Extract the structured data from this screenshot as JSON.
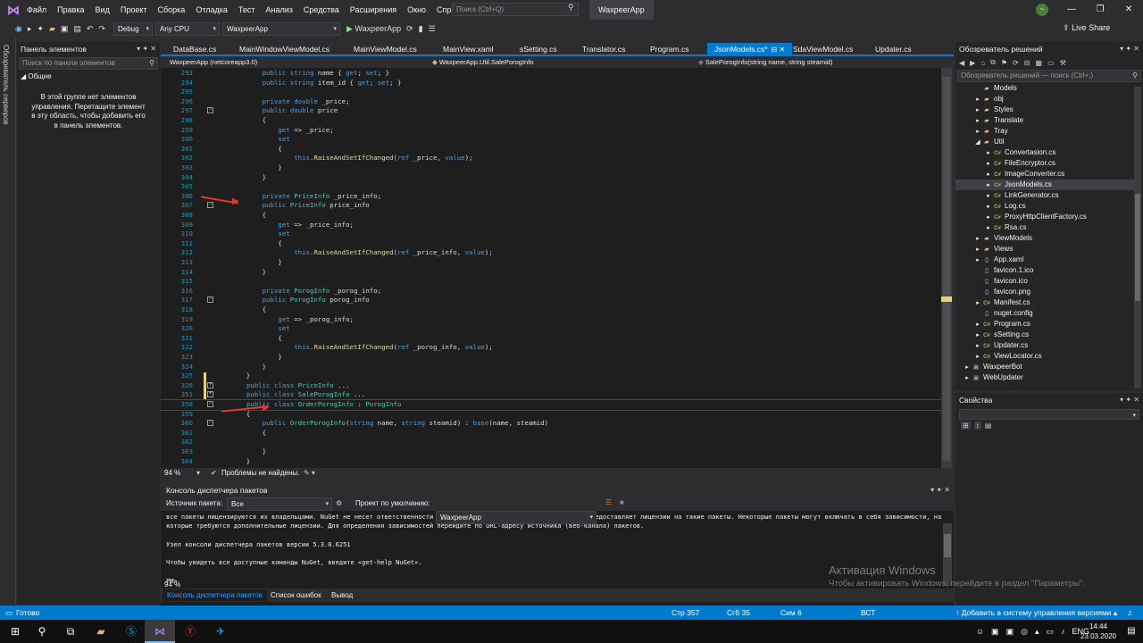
{
  "titlebar": {
    "menus": [
      "Файл",
      "Правка",
      "Вид",
      "Проект",
      "Сборка",
      "Отладка",
      "Тест",
      "Анализ",
      "Средства",
      "Расширения",
      "Окно",
      "Справка"
    ],
    "search_placeholder": "Поиск (Ctrl+Q)",
    "app_name": "WaxpeerApp",
    "live_share": "Live Share"
  },
  "toolbar": {
    "config": "Debug",
    "platform": "Any CPU",
    "startup": "WaxpeerApp",
    "run_label": "WaxpeerApp"
  },
  "sidestrip": {
    "server_explorer": "Обозреватель серверов"
  },
  "toolbox": {
    "title": "Панель элементов",
    "search_placeholder": "Поиск по панели элементов",
    "group": "Общие",
    "empty_text": "В этой группе нет элементов управления. Перетащите элемент в эту область, чтобы добавить его в панель элементов."
  },
  "tabs": [
    {
      "label": "DataBase.cs"
    },
    {
      "label": "MainWindowViewModel.cs"
    },
    {
      "label": "MainViewModel.cs"
    },
    {
      "label": "MainView.xaml"
    },
    {
      "label": "sSetting.cs"
    },
    {
      "label": "Translator.cs"
    },
    {
      "label": "Program.cs"
    },
    {
      "label": "JsonModels.cs*"
    },
    {
      "label": "SdaViewModel.cs"
    },
    {
      "label": "Updater.cs"
    }
  ],
  "navbar": {
    "project": "WaxpeerApp (netcoreapp3.0)",
    "type": "WaxpeerApp.Util.SalePorogInfo",
    "member": "SalePorogInfo(string name, string steamid)"
  },
  "code_lines": [
    {
      "n": "293",
      "t": "        public string name { get; set; }"
    },
    {
      "n": "294",
      "t": "        public string item_id { get; set; }"
    },
    {
      "n": "295",
      "t": ""
    },
    {
      "n": "296",
      "t": "        private double _price;"
    },
    {
      "n": "297",
      "t": "        public double price"
    },
    {
      "n": "298",
      "t": "        {"
    },
    {
      "n": "299",
      "t": "            get => _price;"
    },
    {
      "n": "300",
      "t": "            set"
    },
    {
      "n": "301",
      "t": "            {"
    },
    {
      "n": "302",
      "t": "                this.RaiseAndSetIfChanged(ref _price, value);"
    },
    {
      "n": "303",
      "t": "            }"
    },
    {
      "n": "304",
      "t": "        }"
    },
    {
      "n": "305",
      "t": ""
    },
    {
      "n": "306",
      "t": "        private PriceInfo _price_info;"
    },
    {
      "n": "307",
      "t": "        public PriceInfo price_info"
    },
    {
      "n": "308",
      "t": "        {"
    },
    {
      "n": "309",
      "t": "            get => _price_info;"
    },
    {
      "n": "310",
      "t": "            set"
    },
    {
      "n": "311",
      "t": "            {"
    },
    {
      "n": "312",
      "t": "                this.RaiseAndSetIfChanged(ref _price_info, value);"
    },
    {
      "n": "313",
      "t": "            }"
    },
    {
      "n": "314",
      "t": "        }"
    },
    {
      "n": "315",
      "t": ""
    },
    {
      "n": "316",
      "t": "        private PorogInfo _porog_info;"
    },
    {
      "n": "317",
      "t": "        public PorogInfo porog_info"
    },
    {
      "n": "318",
      "t": "        {"
    },
    {
      "n": "319",
      "t": "            get => _porog_info;"
    },
    {
      "n": "320",
      "t": "            set"
    },
    {
      "n": "321",
      "t": "            {"
    },
    {
      "n": "322",
      "t": "                this.RaiseAndSetIfChanged(ref _porog_info, value);"
    },
    {
      "n": "323",
      "t": "            }"
    },
    {
      "n": "324",
      "t": "        }"
    },
    {
      "n": "325",
      "t": "    }"
    },
    {
      "n": "326",
      "t": "    public class PriceInfo ..."
    },
    {
      "n": "351",
      "t": "    public class SalePorogInfo ..."
    },
    {
      "n": "358",
      "t": "    public class OrderPorogInfo : PorogInfo"
    },
    {
      "n": "359",
      "t": "    {"
    },
    {
      "n": "360",
      "t": "        public OrderPorogInfo(string name, string steamid) : base(name, steamid)"
    },
    {
      "n": "361",
      "t": "        {"
    },
    {
      "n": "362",
      "t": ""
    },
    {
      "n": "363",
      "t": "        }"
    },
    {
      "n": "364",
      "t": "    }"
    }
  ],
  "editor_status": {
    "zoom": "94 %",
    "issues": "Проблемы не найдены."
  },
  "pmc": {
    "title": "Консоль диспетчера пакетов",
    "source_label": "Источник пакета:",
    "source_value": "Все",
    "project_label": "Проект по умолчанию:",
    "project_value": "WaxpeerApp",
    "lines": [
      "все пакеты лицензируются их владельцами. NuGet не несет ответственности за пакеты сторонних производителей и не предоставляет лицензии на такие пакеты. Некоторые пакеты могут включать в себя зависимости, на",
      "которые требуются дополнительные лицензии. Для определения зависимостей перейдите по URL-адресу источника (веб-канала) пакетов.",
      "",
      "Узел консоли диспетчера пакетов версии 5.3.0.6251",
      "",
      "Чтобы увидеть все доступные команды NuGet, введите «get-help NuGet».",
      "",
      "PM>"
    ],
    "zoom": "94 %"
  },
  "bottom_tabs": [
    "Консоль диспетчера пакетов",
    "Список ошибок",
    "Вывод"
  ],
  "solution_explorer": {
    "title": "Обозреватель решений",
    "search_placeholder": "Обозреватель решений — поиск (Ctrl+;)",
    "items": [
      {
        "label": "Models",
        "kind": "folder",
        "depth": 2,
        "exp": ""
      },
      {
        "label": "obj",
        "kind": "folder",
        "depth": 2,
        "exp": "▸"
      },
      {
        "label": "Styles",
        "kind": "folder",
        "depth": 2,
        "exp": "▸"
      },
      {
        "label": "Translate",
        "kind": "folder",
        "depth": 2,
        "exp": "▸"
      },
      {
        "label": "Tray",
        "kind": "folder",
        "depth": 2,
        "exp": "▸"
      },
      {
        "label": "Util",
        "kind": "folder",
        "depth": 2,
        "exp": "◢"
      },
      {
        "label": "Convertasion.cs",
        "kind": "cs",
        "depth": 3,
        "exp": "▸"
      },
      {
        "label": "FileEncryptor.cs",
        "kind": "cs",
        "depth": 3,
        "exp": "▸"
      },
      {
        "label": "ImageConverter.cs",
        "kind": "cs",
        "depth": 3,
        "exp": "▸"
      },
      {
        "label": "JsonModels.cs",
        "kind": "cs",
        "depth": 3,
        "exp": "▸",
        "sel": true
      },
      {
        "label": "LinkGenerator.cs",
        "kind": "cs",
        "depth": 3,
        "exp": "▸"
      },
      {
        "label": "Log.cs",
        "kind": "cs",
        "depth": 3,
        "exp": "▸"
      },
      {
        "label": "ProxyHttpClientFactory.cs",
        "kind": "cs",
        "depth": 3,
        "exp": "▸"
      },
      {
        "label": "Rsa.cs",
        "kind": "cs",
        "depth": 3,
        "exp": "▸"
      },
      {
        "label": "ViewModels",
        "kind": "folder",
        "depth": 2,
        "exp": "▸"
      },
      {
        "label": "Views",
        "kind": "folder",
        "depth": 2,
        "exp": "▸"
      },
      {
        "label": "App.xaml",
        "kind": "file",
        "depth": 2,
        "exp": "▸"
      },
      {
        "label": "favicon.1.ico",
        "kind": "file",
        "depth": 2,
        "exp": ""
      },
      {
        "label": "favicon.ico",
        "kind": "file",
        "depth": 2,
        "exp": ""
      },
      {
        "label": "favicon.png",
        "kind": "file",
        "depth": 2,
        "exp": ""
      },
      {
        "label": "Manifest.cs",
        "kind": "cs",
        "depth": 2,
        "exp": "▸"
      },
      {
        "label": "nuget.config",
        "kind": "file",
        "depth": 2,
        "exp": ""
      },
      {
        "label": "Program.cs",
        "kind": "cs",
        "depth": 2,
        "exp": "▸"
      },
      {
        "label": "sSetting.cs",
        "kind": "cs",
        "depth": 2,
        "exp": "▸"
      },
      {
        "label": "Updater.cs",
        "kind": "cs",
        "depth": 2,
        "exp": "▸"
      },
      {
        "label": "ViewLocator.cs",
        "kind": "cs",
        "depth": 2,
        "exp": "▸"
      },
      {
        "label": "WaxpeerBot",
        "kind": "proj",
        "depth": 1,
        "exp": "▸"
      },
      {
        "label": "WebUpdater",
        "kind": "proj",
        "depth": 1,
        "exp": "▸"
      }
    ]
  },
  "properties": {
    "title": "Свойства"
  },
  "watermark": {
    "title": "Активация Windows",
    "subtitle": "Чтобы активировать Windows, перейдите в раздел \"Параметры\"."
  },
  "statusbar": {
    "ready": "Готово",
    "line": "Стр 357",
    "col": "Сгб 35",
    "char": "Сим 6",
    "mode": "ВСТ",
    "vcs": "Добавить в систему управления версиями"
  },
  "taskbar": {
    "lang": "ENG",
    "time": "14:44",
    "date": "23.03.2020"
  }
}
